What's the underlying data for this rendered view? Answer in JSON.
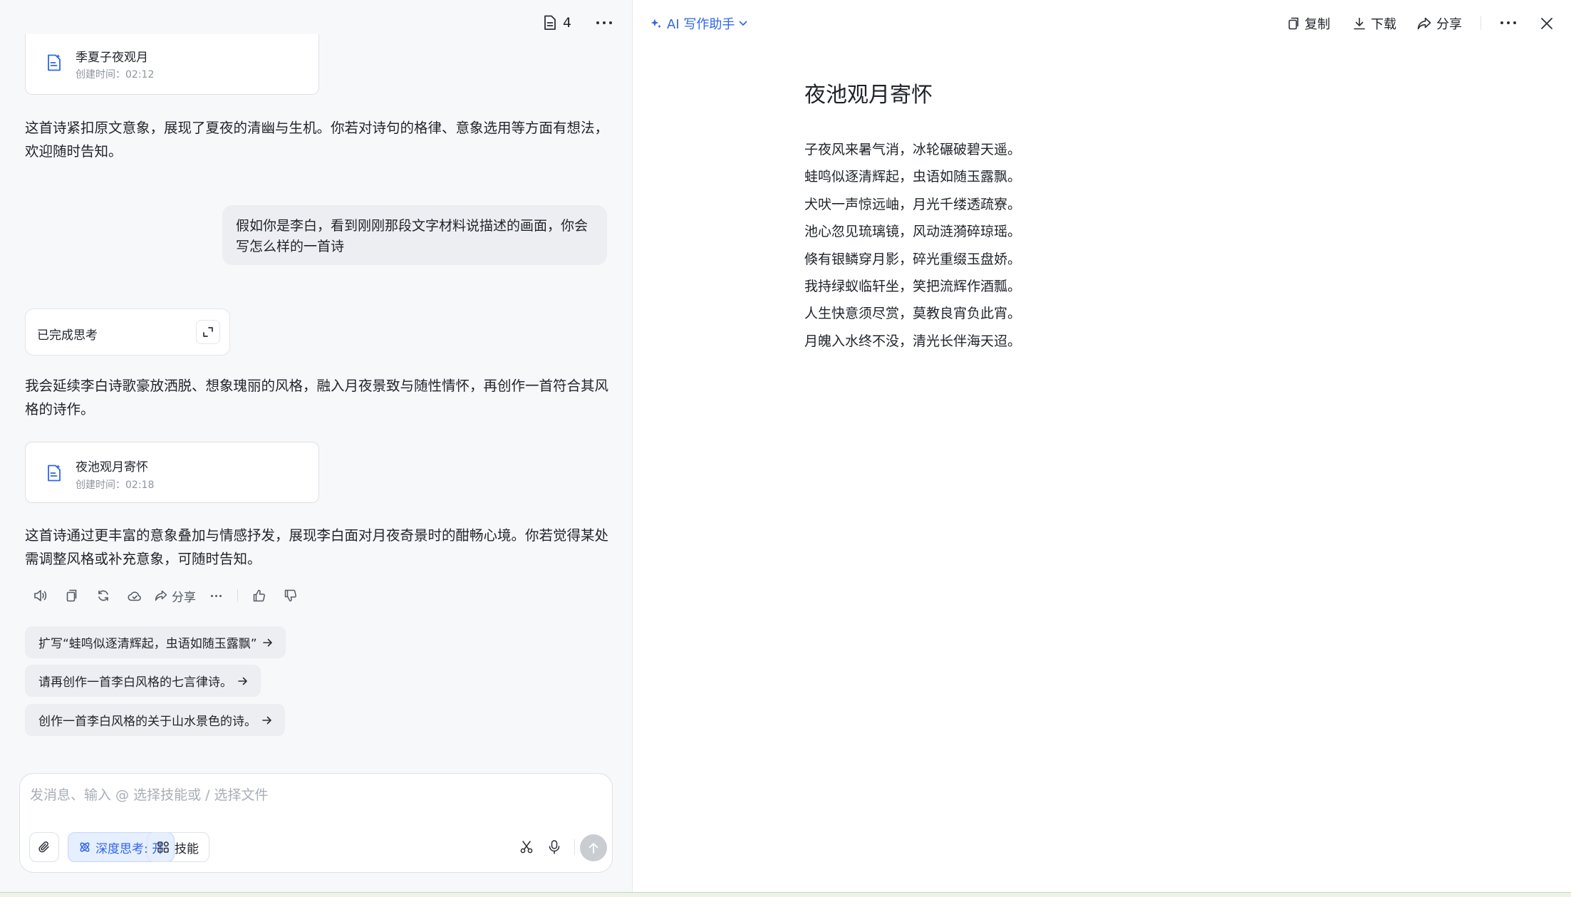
{
  "chat": {
    "doc_count": "4",
    "card1": {
      "title": "季夏子夜观月",
      "time": "创建时间：02:12"
    },
    "para1": "这首诗紧扣原文意象，展现了夏夜的清幽与生机。你若对诗句的格律、意象选用等方面有想法，欢迎随时告知。",
    "user_message": "假如你是李白，看到刚刚那段文字材料说描述的画面，你会写怎么样的一首诗",
    "thinking_label": "已完成思考",
    "para2": "我会延续李白诗歌豪放洒脱、想象瑰丽的风格，融入月夜景致与随性情怀，再创作一首符合其风格的诗作。",
    "card2": {
      "title": "夜池观月寄怀",
      "time": "创建时间：02:18"
    },
    "para3": "这首诗通过更丰富的意象叠加与情感抒发，展现李白面对月夜奇景时的酣畅心境。你若觉得某处需调整风格或补充意象，可随时告知。",
    "actions": {
      "share_label": "分享"
    },
    "suggestions": [
      "扩写“蛙鸣似逐清辉起，虫语如随玉露飘”",
      "请再创作一首李白风格的七言律诗。",
      "创作一首李白风格的关于山水景色的诗。"
    ],
    "composer": {
      "placeholder": "发消息、输入 @ 选择技能或 / 选择文件",
      "deep_think_label": "深度思考: 开",
      "skills_label": "技能"
    }
  },
  "editor": {
    "assistant_label": "AI 写作助手",
    "copy_label": "复制",
    "download_label": "下载",
    "share_label": "分享",
    "title": "夜池观月寄怀",
    "lines": [
      "子夜风来暑气消，冰轮碾破碧天遥。",
      "蛙鸣似逐清辉起，虫语如随玉露飘。",
      "犬吠一声惊远岫，月光千缕透疏寮。",
      "池心忽见琉璃镜，风动涟漪碎琼瑶。",
      "倏有银鳞穿月影，碎光重缀玉盘娇。",
      "我持绿蚁临轩坐，笑把流辉作酒瓢。",
      "人生快意须尽赏，莫教良宵负此宵。",
      "月魄入水终不没，清光长伴海天迢。"
    ]
  },
  "colors": {
    "accent": "#2f66e8",
    "bubble": "#eceef1",
    "pane_bg": "#f7f8fa"
  }
}
